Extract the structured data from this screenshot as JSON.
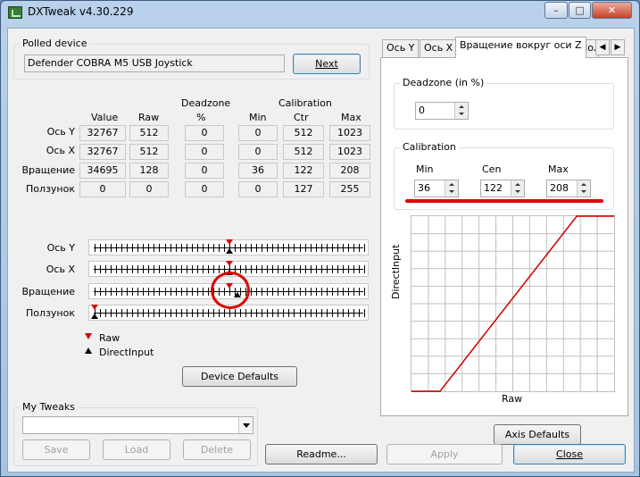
{
  "window": {
    "title": "DXTweak v4.30.229"
  },
  "polled_device": {
    "group_label": "Polled device",
    "device_name": "Defender COBRA M5 USB Joystick",
    "next_label": "Next"
  },
  "table": {
    "headers": {
      "value": "Value",
      "raw": "Raw",
      "deadzone_top": "Deadzone",
      "deadzone_unit": "%",
      "calibration": "Calibration",
      "min": "Min",
      "ctr": "Ctr",
      "max": "Max"
    },
    "rows": [
      {
        "label": "Ось Y",
        "value": "32767",
        "raw": "512",
        "deadzone": "0",
        "min": "0",
        "ctr": "512",
        "max": "1023"
      },
      {
        "label": "Ось X",
        "value": "32767",
        "raw": "512",
        "deadzone": "0",
        "min": "0",
        "ctr": "512",
        "max": "1023"
      },
      {
        "label": "Вращение",
        "value": "34695",
        "raw": "128",
        "deadzone": "0",
        "min": "36",
        "ctr": "122",
        "max": "208"
      },
      {
        "label": "Ползунок",
        "value": "0",
        "raw": "0",
        "deadzone": "0",
        "min": "0",
        "ctr": "127",
        "max": "255"
      }
    ]
  },
  "sliders": [
    {
      "label": "Ось Y",
      "raw_pos": 0.5,
      "di_pos": 0.5
    },
    {
      "label": "Ось X",
      "raw_pos": 0.5,
      "di_pos": 0.5
    },
    {
      "label": "Вращение",
      "raw_pos": 0.5,
      "di_pos": 0.53
    },
    {
      "label": "Ползунок",
      "raw_pos": 0.0,
      "di_pos": 0.0
    }
  ],
  "legend": {
    "raw": "Raw",
    "directinput": "DirectInput"
  },
  "device_defaults_label": "Device Defaults",
  "my_tweaks": {
    "group_label": "My Tweaks",
    "combo_value": "",
    "save_label": "Save",
    "load_label": "Load",
    "delete_label": "Delete"
  },
  "tabs": [
    "Ось Y",
    "Ось X",
    "Вращение вокруг оси Z",
    "Пол"
  ],
  "axis_panel": {
    "deadzone_label": "Deadzone (in %)",
    "deadzone_value": "0",
    "calibration_label": "Calibration",
    "min_label": "Min",
    "cen_label": "Cen",
    "max_label": "Max",
    "min_value": "36",
    "cen_value": "122",
    "max_value": "208",
    "chart_ylabel": "DirectInput",
    "chart_xlabel": "Raw",
    "axis_defaults_label": "Axis Defaults"
  },
  "chart_data": {
    "type": "line",
    "xlabel": "Raw",
    "ylabel": "DirectInput",
    "xlim": [
      0,
      255
    ],
    "ylim": [
      0,
      65535
    ],
    "grid": true,
    "series": [
      {
        "x": [
          0,
          36,
          208,
          255
        ],
        "values": [
          0,
          0,
          65535,
          65535
        ]
      }
    ],
    "colors": {
      "line": "#cc0000"
    }
  },
  "bottom": {
    "readme_label": "Readme...",
    "apply_label": "Apply",
    "close_label": "Close"
  },
  "colors": {
    "raw_marker": "#dd0000",
    "annotation": "#e00000"
  }
}
